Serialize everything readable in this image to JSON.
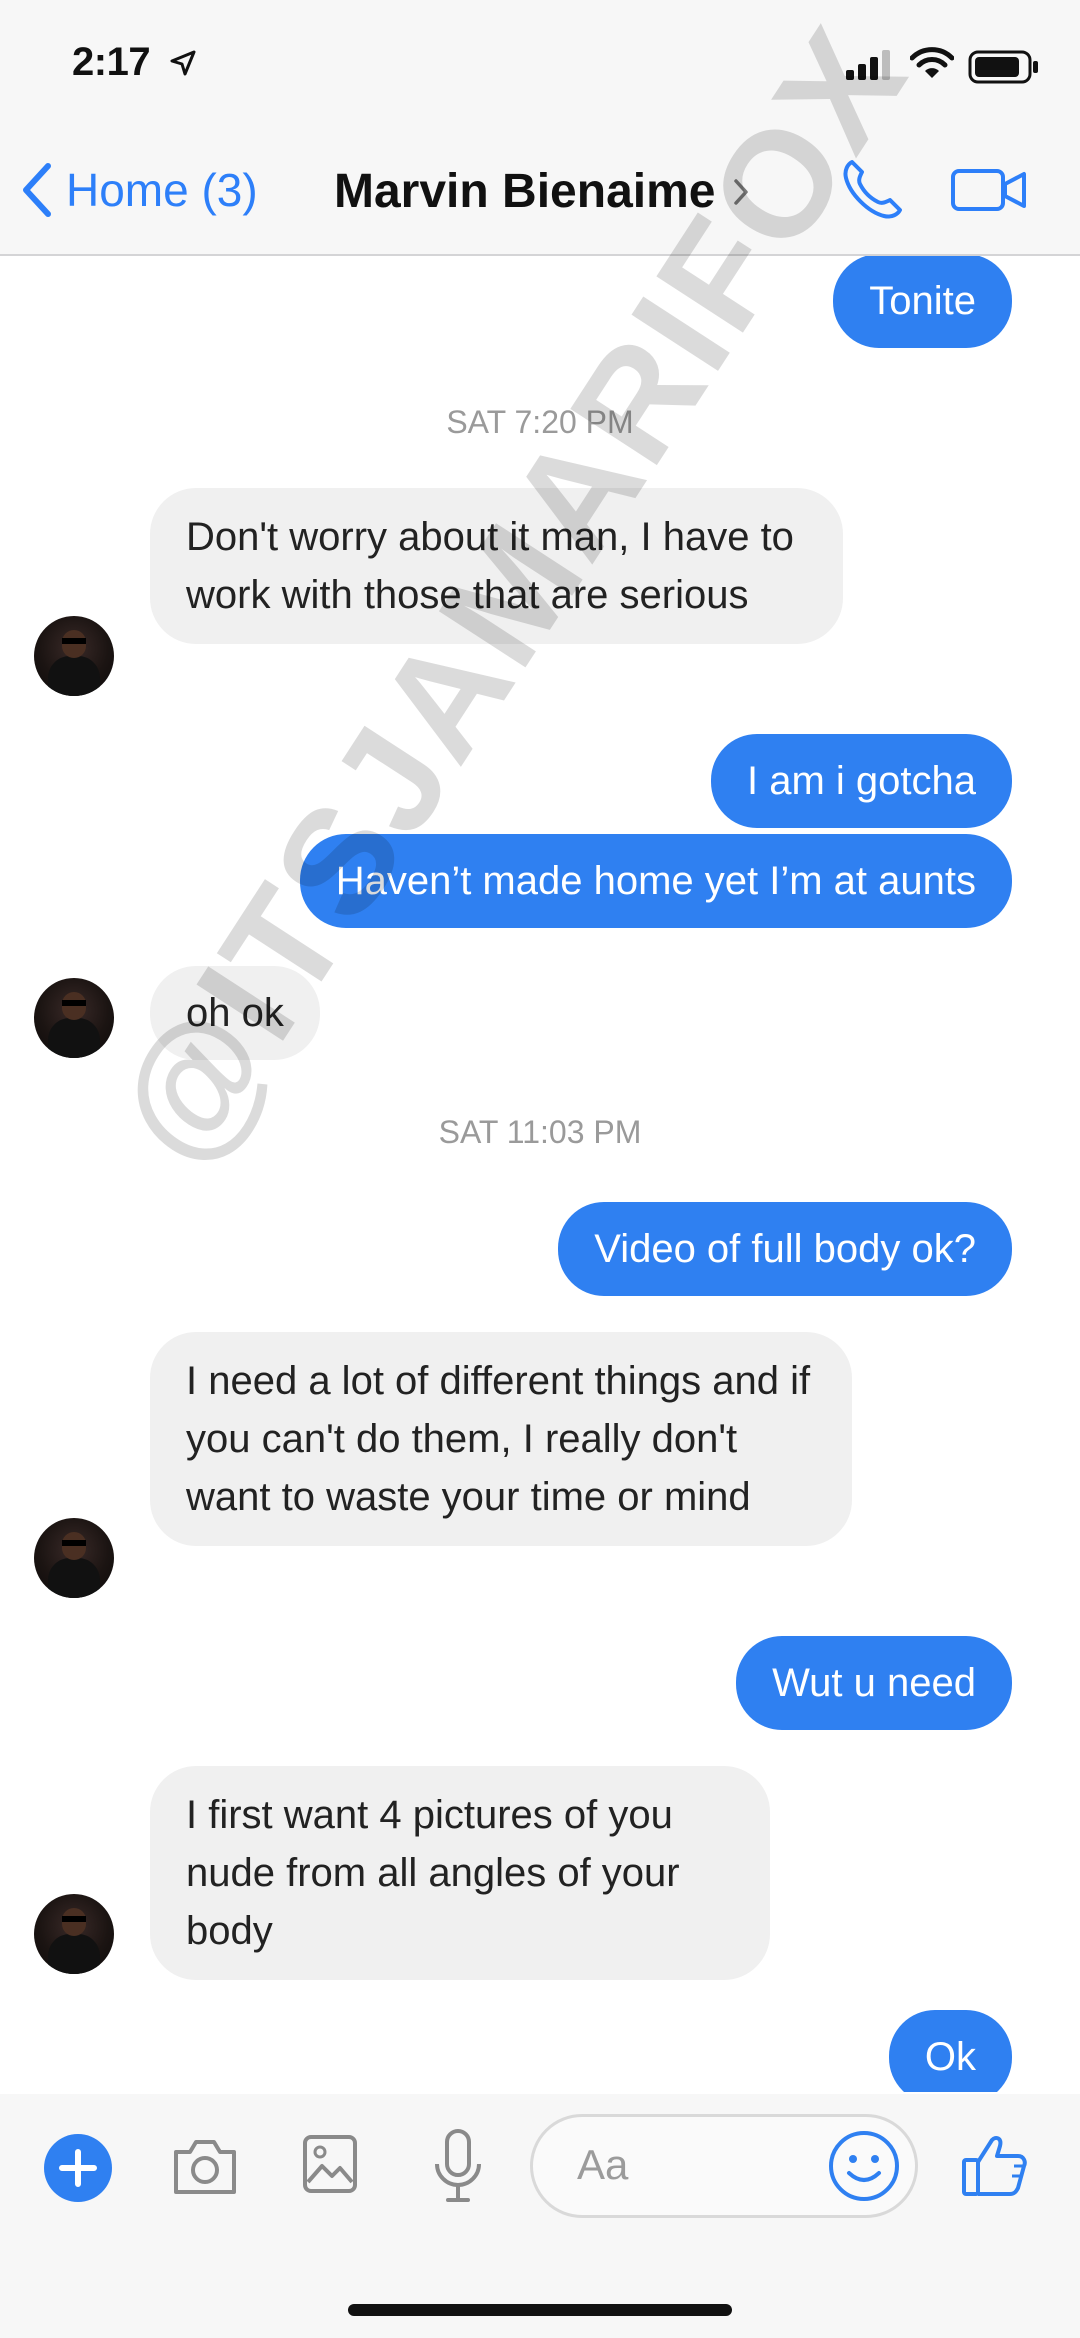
{
  "status_bar": {
    "time": "2:17"
  },
  "nav": {
    "back_label": "Home (3)",
    "contact_name": "Marvin Bienaime"
  },
  "messages": [
    {
      "dir": "out",
      "text": "Tonite"
    },
    {
      "type": "timestamp",
      "text": "SAT 7:20 PM"
    },
    {
      "dir": "in",
      "text": "Don't worry about it man, I have to work with those that are serious"
    },
    {
      "dir": "out",
      "text": "I am i gotcha"
    },
    {
      "dir": "out",
      "text": "Haven’t made home yet I’m at aunts"
    },
    {
      "dir": "in",
      "text": "oh ok"
    },
    {
      "type": "timestamp",
      "text": "SAT 11:03 PM"
    },
    {
      "dir": "out",
      "text": "Video of full body ok?"
    },
    {
      "dir": "in",
      "text": "I need a lot of different things and if you can't do them, I really don't want to waste your time or mind"
    },
    {
      "dir": "out",
      "text": "Wut u need"
    },
    {
      "dir": "in",
      "text": "I first want 4 pictures of you nude from all angles of your body"
    },
    {
      "dir": "out",
      "text": "Ok"
    }
  ],
  "composer": {
    "placeholder": "Aa"
  },
  "watermark": "@ITSJAMARIFOX",
  "colors": {
    "accent": "#2f80f1",
    "incoming_bubble": "#f0f0f0",
    "bar_bg": "#f7f7f7"
  },
  "icons": [
    "location-arrow-icon",
    "signal-icon",
    "wifi-icon",
    "battery-icon",
    "chevron-left-icon",
    "chevron-right-icon",
    "phone-icon",
    "video-camera-icon",
    "plus-icon",
    "camera-icon",
    "image-icon",
    "microphone-icon",
    "emoji-icon",
    "thumbs-up-icon"
  ]
}
